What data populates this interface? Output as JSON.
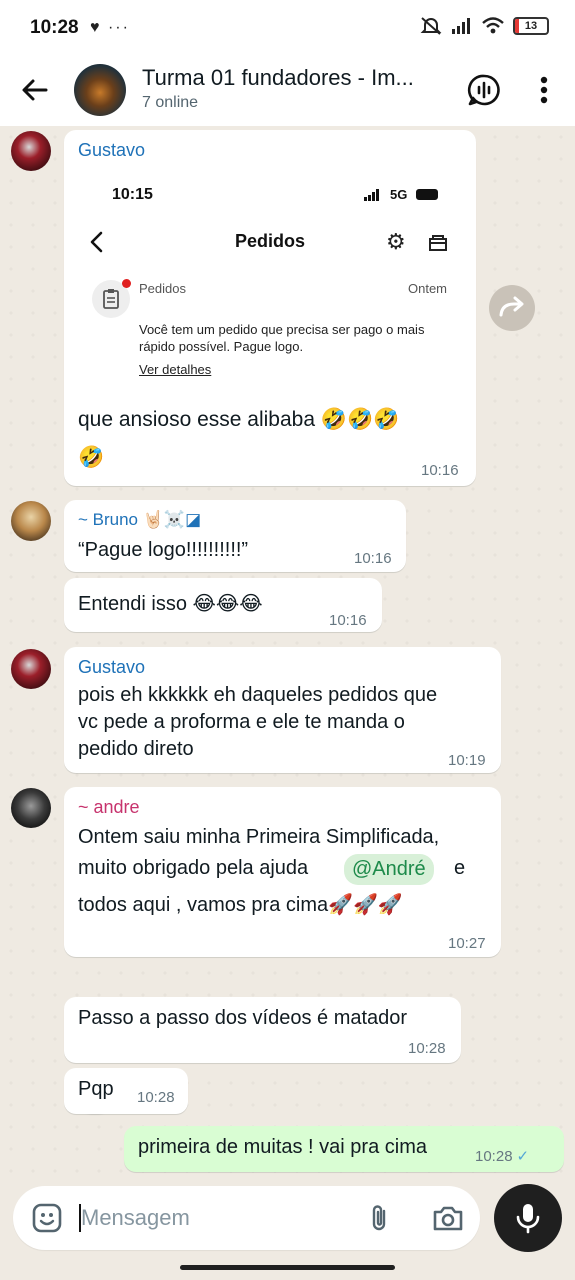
{
  "status_bar": {
    "time": "10:28",
    "left_icons": "♥ ···",
    "battery": "13",
    "battery_level": 0.13
  },
  "header": {
    "title": "Turma 01 fundadores  - Im...",
    "subtitle": "7 online",
    "icons": [
      "back-arrow-icon",
      "group-avatar",
      "voice-chat-icon",
      "more-vertical-icon"
    ]
  },
  "messages": [
    {
      "sender": "Gustavo",
      "embed": {
        "time": "10:15",
        "network": "5G",
        "title": "Pedidos",
        "notif_title": "Pedidos",
        "notif_date": "Ontem",
        "notif_body": "Você tem um pedido que precisa ser pago o mais rápido possível. Pague logo.",
        "link": "Ver detalhes"
      },
      "text": "que ansioso esse alibaba 🤣🤣🤣",
      "text2": "🤣",
      "time": "10:16"
    },
    {
      "sender": "~ Bruno 🤘🏻☠️◪",
      "text": "“Pague logo!!!!!!!!!!”",
      "time": "10:16"
    },
    {
      "text": "Entendi isso 😂😂😂",
      "time": "10:16"
    },
    {
      "sender": "Gustavo",
      "lines": [
        "pois eh kkkkkk eh daqueles pedidos que",
        "vc pede a proforma e ele te manda o",
        "pedido direto"
      ],
      "time": "10:19"
    },
    {
      "sender": "~ andre",
      "lines": [
        "Ontem saiu minha Primeira Simplificada,",
        "muito obrigado pela ajuda",
        "todos aqui , vamos pra cima🚀🚀🚀"
      ],
      "mention": "@André",
      "mention_after": "e",
      "time": "10:27",
      "reaction": "❤️"
    },
    {
      "text": "Passo a passo dos vídeos é matador",
      "time": "10:28"
    },
    {
      "text": "Pqp",
      "time": "10:28"
    },
    {
      "text": "primeira de muitas ! vai pra cima",
      "time": "10:28",
      "outgoing": true,
      "status": "✓"
    }
  ],
  "composer": {
    "placeholder": "Mensagem",
    "icons": [
      "emoji-icon",
      "attach-icon",
      "camera-icon",
      "mic-icon"
    ]
  },
  "colors": {
    "incoming": "#ffffff",
    "outgoing": "#d9fdd3",
    "background": "#efeae2",
    "sender_blue": "#1f72b8",
    "sender_pink": "#c7336d"
  }
}
